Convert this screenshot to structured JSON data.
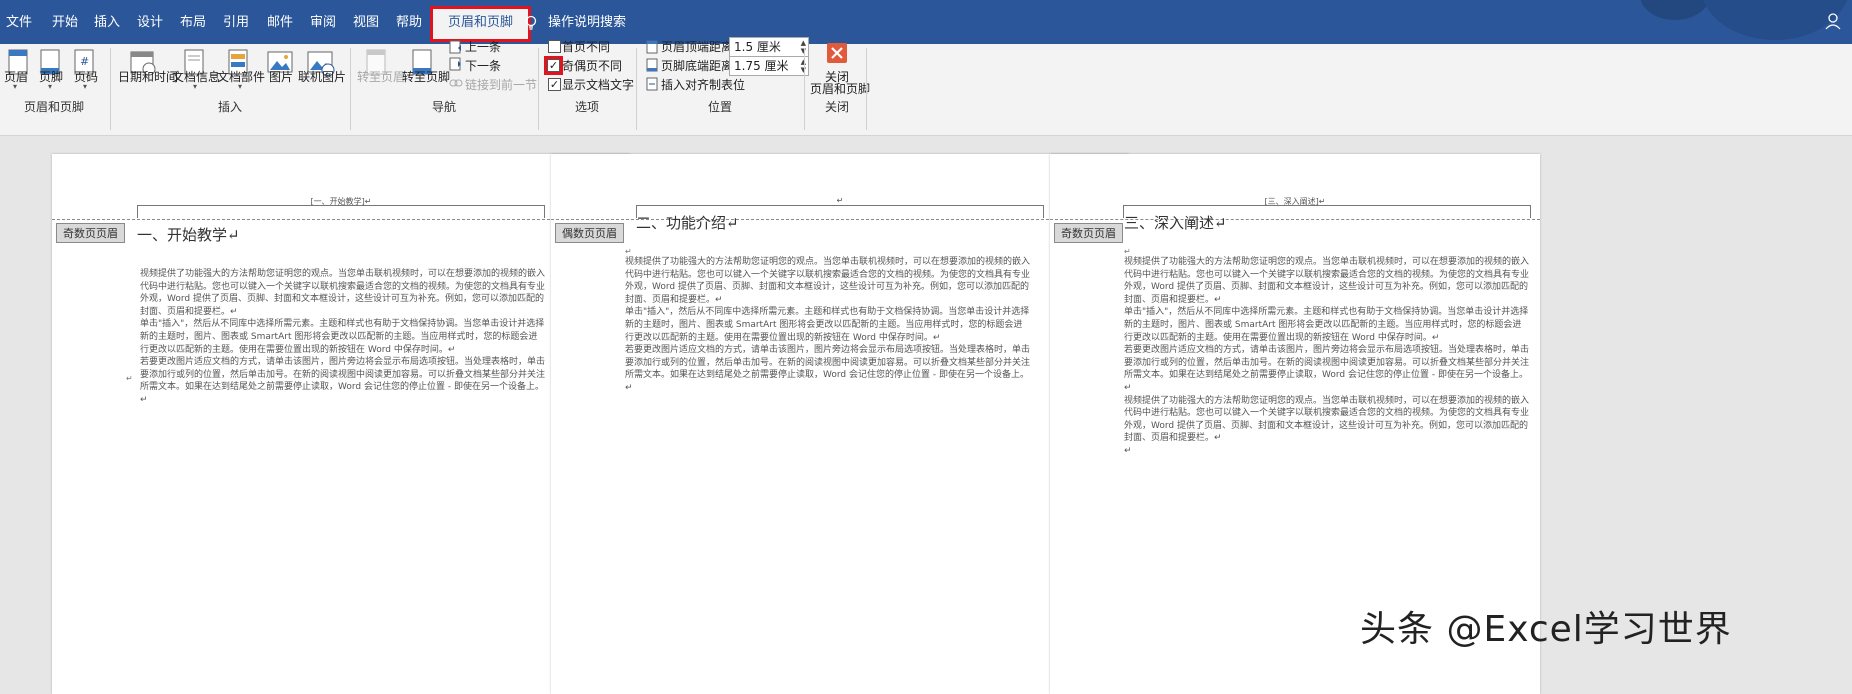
{
  "tabs": {
    "file": "文件",
    "home": "开始",
    "insert": "插入",
    "design": "设计",
    "layout": "布局",
    "references": "引用",
    "mailings": "邮件",
    "review": "审阅",
    "view": "视图",
    "help": "帮助",
    "header_footer": "页眉和页脚",
    "tell_me": "操作说明搜索"
  },
  "ribbon": {
    "header": "页眉",
    "footer": "页脚",
    "page_number": "页码",
    "group_hf": "页眉和页脚",
    "datetime": "日期和时间",
    "docinfo": "文档信息",
    "docparts": "文档部件",
    "picture": "图片",
    "online_picture": "联机图片",
    "group_insert": "插入",
    "goto_header": "转至页眉",
    "goto_footer": "转至页脚",
    "prev": "上一条",
    "next": "下一条",
    "link_prev": "链接到前一节",
    "group_nav": "导航",
    "diff_first": "首页不同",
    "diff_odd_even": "奇偶页不同",
    "show_doc_text": "显示文档文字",
    "group_options": "选项",
    "header_top": "页眉顶端距离:",
    "header_top_val": "1.5 厘米",
    "footer_bottom": "页脚底端距离:",
    "footer_bottom_val": "1.75 厘米",
    "insert_align_tab": "插入对齐制表位",
    "group_position": "位置",
    "close_line1": "关闭",
    "close_line2": "页眉和页脚",
    "group_close": "关闭"
  },
  "pages": [
    {
      "header_text": "[一、开始教学]↵",
      "tag": "奇数页页眉",
      "title": "一、开始教学↵",
      "paragraphs": [
        "↵",
        "视频提供了功能强大的方法帮助您证明您的观点。当您单击联机视频时，可以在想要添加的视频的嵌入代码中进行粘贴。您也可以键入一个关键字以联机搜索最适合您的文档的视频。为使您的文档具有专业外观，Word 提供了页眉、页脚、封面和文本框设计，这些设计可互为补充。例如，您可以添加匹配的封面、页眉和提要栏。↵",
        "单击\"插入\"，然后从不同库中选择所需元素。主题和样式也有助于文档保持协调。当您单击设计并选择新的主题时，图片、图表或 SmartArt 图形将会更改以匹配新的主题。当应用样式时，您的标题会进行更改以匹配新的主题。使用在需要位置出现的新按钮在 Word 中保存时间。↵",
        "若要更改图片适应文档的方式，请单击该图片，图片旁边将会显示布局选项按钮。当处理表格时，单击要添加行或列的位置，然后单击加号。在新的阅读视图中阅读更加容易。可以折叠文档某些部分并关注所需文本。如果在达到结尾处之前需要停止读取，Word 会记住您的停止位置 - 即使在另一个设备上。↵"
      ]
    },
    {
      "header_text": "↵",
      "tag": "偶数页页眉",
      "title": "二、功能介绍↵",
      "paragraphs": [
        "↵",
        "视频提供了功能强大的方法帮助您证明您的观点。当您单击联机视频时，可以在想要添加的视频的嵌入代码中进行粘贴。您也可以键入一个关键字以联机搜索最适合您的文档的视频。为使您的文档具有专业外观，Word 提供了页眉、页脚、封面和文本框设计，这些设计可互为补充。例如，您可以添加匹配的封面、页眉和提要栏。↵",
        "单击\"插入\"，然后从不同库中选择所需元素。主题和样式也有助于文档保持协调。当您单击设计并选择新的主题时，图片、图表或 SmartArt 图形将会更改以匹配新的主题。当应用样式时，您的标题会进行更改以匹配新的主题。使用在需要位置出现的新按钮在 Word 中保存时间。↵",
        "若要更改图片适应文档的方式，请单击该图片，图片旁边将会显示布局选项按钮。当处理表格时，单击要添加行或列的位置，然后单击加号。在新的阅读视图中阅读更加容易。可以折叠文档某些部分并关注所需文本。如果在达到结尾处之前需要停止读取，Word 会记住您的停止位置 - 即使在另一个设备上。↵"
      ]
    },
    {
      "header_text": "[三、深入阐述]↵",
      "tag": "奇数页页眉",
      "title": "三、深入阐述↵",
      "paragraphs": [
        "↵",
        "视频提供了功能强大的方法帮助您证明您的观点。当您单击联机视频时，可以在想要添加的视频的嵌入代码中进行粘贴。您也可以键入一个关键字以联机搜索最适合您的文档的视频。为使您的文档具有专业外观，Word 提供了页眉、页脚、封面和文本框设计，这些设计可互为补充。例如，您可以添加匹配的封面、页眉和提要栏。↵",
        "单击\"插入\"，然后从不同库中选择所需元素。主题和样式也有助于文档保持协调。当您单击设计并选择新的主题时，图片、图表或 SmartArt 图形将会更改以匹配新的主题。当应用样式时，您的标题会进行更改以匹配新的主题。使用在需要位置出现的新按钮在 Word 中保存时间。↵",
        "若要更改图片适应文档的方式，请单击该图片，图片旁边将会显示布局选项按钮。当处理表格时，单击要添加行或列的位置，然后单击加号。在新的阅读视图中阅读更加容易。可以折叠文档某些部分并关注所需文本。如果在达到结尾处之前需要停止读取，Word 会记住您的停止位置 - 即使在另一个设备上。↵",
        "视频提供了功能强大的方法帮助您证明您的观点。当您单击联机视频时，可以在想要添加的视频的嵌入代码中进行粘贴。您也可以键入一个关键字以联机搜索最适合您的文档的视频。为使您的文档具有专业外观，Word 提供了页眉、页脚、封面和文本框设计，这些设计可互为补充。例如，您可以添加匹配的封面、页眉和提要栏。↵",
        "↵"
      ]
    }
  ],
  "watermark": "头条 @Excel学习世界",
  "colors": {
    "brand": "#2b579a",
    "highlight": "#e0141e",
    "close_button": "#e05a3c"
  }
}
